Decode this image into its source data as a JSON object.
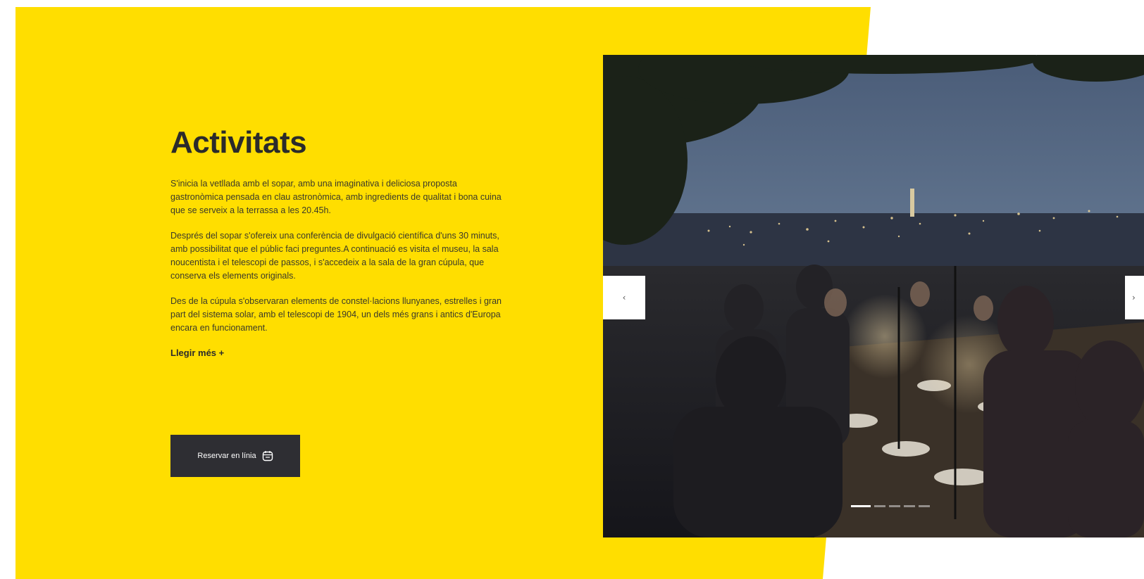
{
  "section": {
    "title": "Activitats",
    "paragraphs": [
      "S'inicia la vetllada amb el sopar, amb una imaginativa i deliciosa proposta gastronòmica pensada en clau astronòmica, amb ingredients de qualitat i bona cuina que se serveix a la terrassa a les 20.45h.",
      "Després del sopar s'ofereix una conferència de divulgació científica d'uns 30 minuts, amb possibilitat que el públic faci preguntes.A continuació es visita el museu, la sala noucentista i el telescopi de passos, i s'accedeix a la sala de la gran cúpula, que conserva els elements originals.",
      "Des de la cúpula s'observaran elements de constel·lacions llunyanes, estrelles i gran part del sistema solar, amb el telescopi de 1904, un dels més grans i antics d'Europa encara en funcionament."
    ],
    "read_more": "Llegir més +",
    "reserve_button": "Reservar en línia"
  },
  "carousel": {
    "prev_label": "‹",
    "next_label": "›",
    "slide_count": 5,
    "active_slide": 1
  },
  "colors": {
    "brand_yellow": "#FFDE00",
    "button_dark": "#2E2E33",
    "text_dark": "#2B2B2B"
  },
  "icons": {
    "reserve": "calendar-icon"
  }
}
